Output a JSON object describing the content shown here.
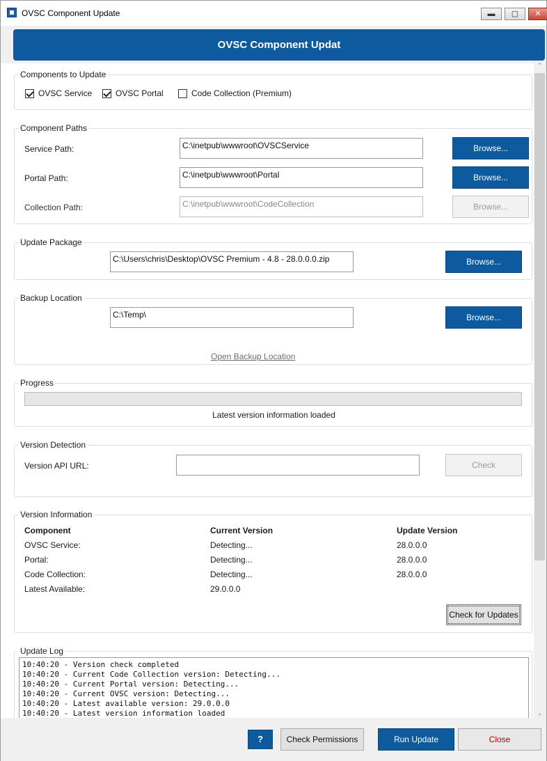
{
  "window": {
    "title": "OVSC Component Update",
    "controls": {
      "minimize": "▬",
      "maximize": "▢",
      "close": "✕"
    }
  },
  "header": {
    "title": "OVSC Component Updat"
  },
  "components": {
    "legend": "Components to Update",
    "items": [
      {
        "label": "OVSC Service",
        "checked": true
      },
      {
        "label": "OVSC Portal",
        "checked": true
      },
      {
        "label": "Code Collection (Premium)",
        "checked": false
      }
    ]
  },
  "paths": {
    "legend": "Component Paths",
    "service_label": "Service Path:",
    "service_value": "C:\\inetpub\\wwwroot\\OVSCService",
    "portal_label": "Portal Path:",
    "portal_value": "C:\\inetpub\\wwwroot\\Portal",
    "collection_label": "Collection Path:",
    "collection_value": "C:\\inetpub\\wwwroot\\CodeCollection",
    "browse": "Browse..."
  },
  "package": {
    "legend": "Update Package",
    "value": "C:\\Users\\chris\\Desktop\\OVSC Premium - 4.8 - 28.0.0.0.zip",
    "browse": "Browse..."
  },
  "backup": {
    "legend": "Backup Location",
    "value": "C:\\Temp\\",
    "browse": "Browse...",
    "open_link": "Open Backup Location"
  },
  "progress": {
    "legend": "Progress",
    "fraction": 0,
    "status": "Latest version information loaded"
  },
  "detection": {
    "legend": "Version Detection",
    "api_label": "Version API URL:",
    "api_value": "",
    "check": "Check"
  },
  "version_info": {
    "legend": "Version Information",
    "headers": [
      "Component",
      "Current Version",
      "Update Version"
    ],
    "rows": [
      [
        "OVSC Service:",
        "Detecting...",
        "28.0.0.0"
      ],
      [
        "Portal:",
        "Detecting...",
        "28.0.0.0"
      ],
      [
        "Code Collection:",
        "Detecting...",
        "28.0.0.0"
      ],
      [
        "Latest Available:",
        "29.0.0.0",
        ""
      ]
    ],
    "check_updates": "Check for Updates"
  },
  "log": {
    "legend": "Update Log",
    "lines": [
      "10:40:20 - Version check completed",
      "10:40:20 - Current Code Collection version: Detecting...",
      "10:40:20 - Current Portal version: Detecting...",
      "10:40:20 - Current OVSC version: Detecting...",
      "10:40:20 - Latest available version: 29.0.0.0",
      "10:40:20 - Latest version information loaded"
    ]
  },
  "footer": {
    "help": "?",
    "check_permissions": "Check Permissions",
    "run_update": "Run Update",
    "close": "Close"
  },
  "colors": {
    "brand": "#0e5a9e",
    "close_text": "#c00000"
  },
  "icons": {
    "scroll_up": "⌃",
    "scroll_down": "⌄"
  }
}
